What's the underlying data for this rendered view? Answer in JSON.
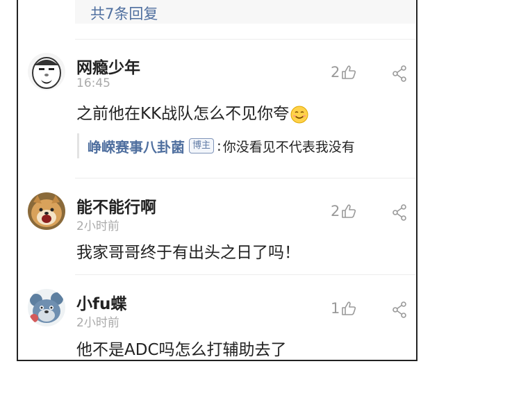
{
  "thread": {
    "reply_count_label": "共7条回复"
  },
  "comments": [
    {
      "username": "网瘾少年",
      "time": "16:45",
      "likes": "2",
      "content": "之前他在KK战队怎么不见你夸",
      "content_emoji": "smile-emoji",
      "avatar_icon": "meme-face-avatar",
      "reply": {
        "author": "峥嵘赛事八卦菌",
        "badge": "博主",
        "text": "你没看见不代表我没有"
      }
    },
    {
      "username": "能不能行啊",
      "time": "2小时前",
      "likes": "2",
      "content": "我家哥哥终于有出头之日了吗！",
      "avatar_icon": "shiba-dog-avatar"
    },
    {
      "username": "小fu蝶",
      "time": "2小时前",
      "likes": "1",
      "content": "他不是ADC吗怎么打辅助去了",
      "avatar_icon": "cartoon-mouse-avatar"
    }
  ],
  "icons": {
    "like": "thumbs-up-icon",
    "share": "share-icon"
  },
  "colors": {
    "link_blue": "#4f6f9f",
    "muted_gray": "#999999",
    "text": "#222222"
  }
}
